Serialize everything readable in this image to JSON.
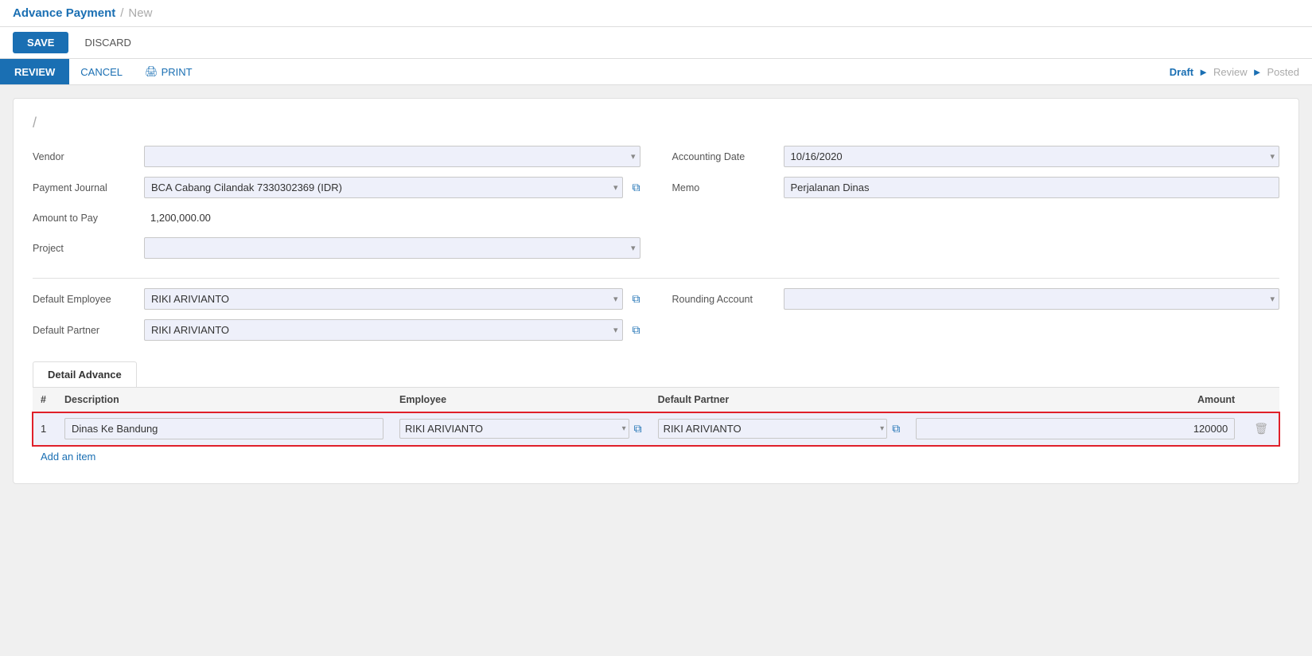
{
  "breadcrumb": {
    "main": "Advance Payment",
    "separator": "/",
    "sub": "New"
  },
  "actions": {
    "save_label": "SAVE",
    "discard_label": "DISCARD"
  },
  "workflow": {
    "review_label": "REVIEW",
    "cancel_label": "CANCEL",
    "print_label": "PRINT",
    "steps": [
      "Draft",
      "Review",
      "Posted"
    ],
    "active_step": "Draft"
  },
  "record_title": "/",
  "form": {
    "vendor_label": "Vendor",
    "vendor_value": "",
    "payment_journal_label": "Payment Journal",
    "payment_journal_value": "BCA Cabang Cilandak 7330302369 (IDR)",
    "amount_to_pay_label": "Amount to Pay",
    "amount_to_pay_value": "1,200,000.00",
    "project_label": "Project",
    "project_value": "",
    "accounting_date_label": "Accounting Date",
    "accounting_date_value": "10/16/2020",
    "memo_label": "Memo",
    "memo_value": "Perjalanan Dinas",
    "default_employee_label": "Default Employee",
    "default_employee_value": "RIKI ARIVIANTO",
    "default_partner_label": "Default Partner",
    "default_partner_value": "RIKI ARIVIANTO",
    "rounding_account_label": "Rounding Account",
    "rounding_account_value": ""
  },
  "tabs": [
    {
      "label": "Detail Advance",
      "active": true
    }
  ],
  "table": {
    "columns": [
      "#",
      "Description",
      "Employee",
      "Default Partner",
      "Amount"
    ],
    "rows": [
      {
        "num": "1",
        "description": "Dinas Ke Bandung",
        "employee": "RIKI ARIVIANTO",
        "default_partner": "RIKI ARIVIANTO",
        "amount": "120000"
      }
    ],
    "add_item_label": "Add an item"
  }
}
